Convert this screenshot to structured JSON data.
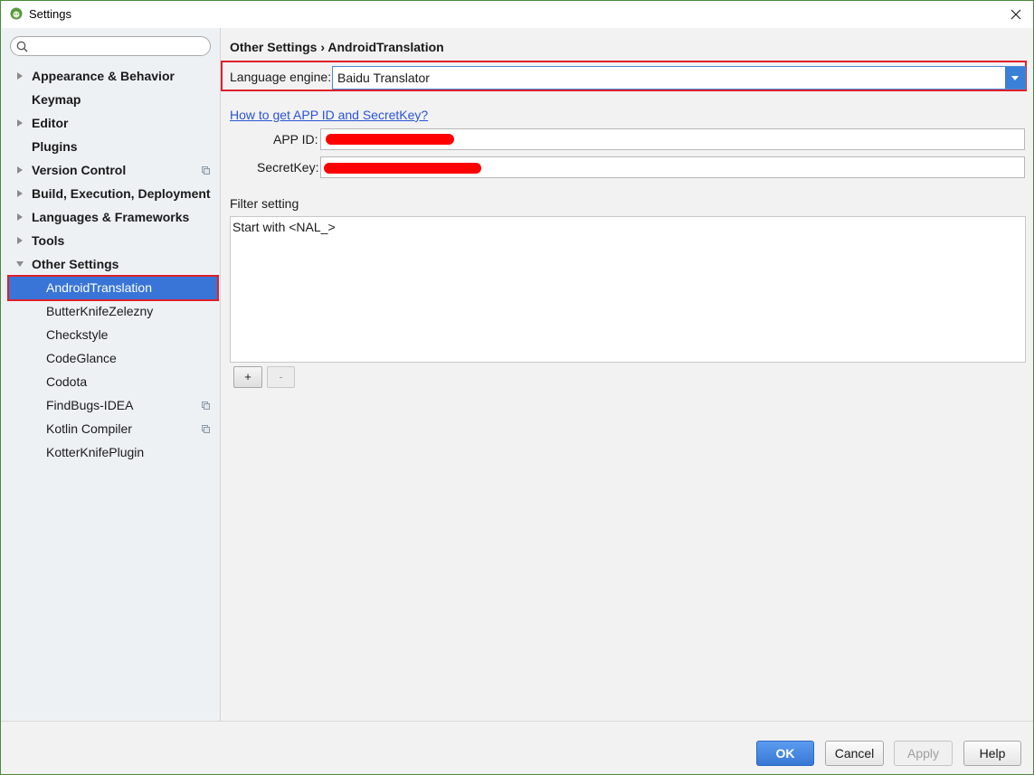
{
  "window": {
    "title": "Settings"
  },
  "sidebar": {
    "search_placeholder": "",
    "items": [
      {
        "label": "Appearance & Behavior",
        "level": 0,
        "expandable": true,
        "expanded": false,
        "project": false
      },
      {
        "label": "Keymap",
        "level": 0,
        "expandable": false,
        "project": false
      },
      {
        "label": "Editor",
        "level": 0,
        "expandable": true,
        "expanded": false,
        "project": false
      },
      {
        "label": "Plugins",
        "level": 0,
        "expandable": false,
        "project": false
      },
      {
        "label": "Version Control",
        "level": 0,
        "expandable": true,
        "expanded": false,
        "project": true
      },
      {
        "label": "Build, Execution, Deployment",
        "level": 0,
        "expandable": true,
        "expanded": false,
        "project": false
      },
      {
        "label": "Languages & Frameworks",
        "level": 0,
        "expandable": true,
        "expanded": false,
        "project": false
      },
      {
        "label": "Tools",
        "level": 0,
        "expandable": true,
        "expanded": false,
        "project": false
      },
      {
        "label": "Other Settings",
        "level": 0,
        "expandable": true,
        "expanded": true,
        "project": false
      },
      {
        "label": "AndroidTranslation",
        "level": 1,
        "selected": true,
        "project": false
      },
      {
        "label": "ButterKnifeZelezny",
        "level": 1,
        "project": false
      },
      {
        "label": "Checkstyle",
        "level": 1,
        "project": false
      },
      {
        "label": "CodeGlance",
        "level": 1,
        "project": false
      },
      {
        "label": "Codota",
        "level": 1,
        "project": false
      },
      {
        "label": "FindBugs-IDEA",
        "level": 1,
        "project": true
      },
      {
        "label": "Kotlin Compiler",
        "level": 1,
        "project": true
      },
      {
        "label": "KotterKnifePlugin",
        "level": 1,
        "project": false
      }
    ]
  },
  "content": {
    "breadcrumb": "Other Settings › AndroidTranslation",
    "engine_label": "Language engine:",
    "engine_value": "Baidu Translator",
    "help_link": "How to get APP ID and SecretKey?",
    "app_id_label": "APP ID:",
    "secret_key_label": "SecretKey:",
    "filter_title": "Filter setting",
    "filter_items": [
      "Start with <NAL_>"
    ],
    "add_label": "+",
    "remove_label": "-"
  },
  "footer": {
    "ok_label": "OK",
    "cancel_label": "Cancel",
    "apply_label": "Apply",
    "help_label": "Help"
  },
  "colors": {
    "selection": "#3875d7",
    "highlight_border": "#e0202a",
    "link": "#2b53d6",
    "ok_button": "#3878d6",
    "redaction": "#ff0000"
  }
}
